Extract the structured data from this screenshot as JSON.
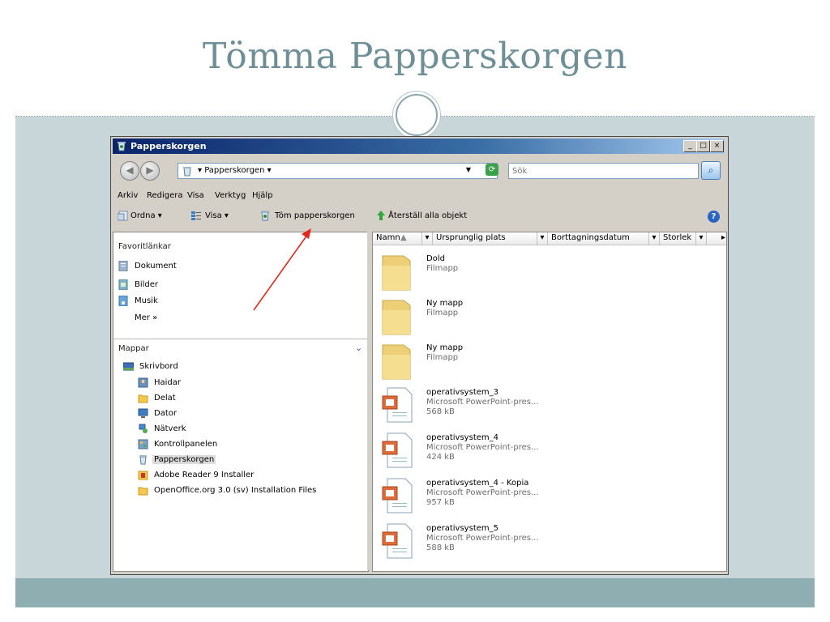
{
  "slide": {
    "title": "Tömma Papperskorgen"
  },
  "window": {
    "title": "Papperskorgen",
    "controls": {
      "minimize": "_",
      "maximize": "□",
      "close": "×"
    },
    "address": {
      "location": "▾ Papperskorgen ▾",
      "search_placeholder": "Sök"
    },
    "menu": [
      "Arkiv",
      "Redigera",
      "Visa",
      "Verktyg",
      "Hjälp"
    ],
    "toolbar": {
      "organize": "Ordna ▾",
      "view": "Visa ▾",
      "empty": "Töm papperskorgen",
      "restore": "Återställ alla objekt",
      "help": "?"
    },
    "favorites": {
      "header": "Favoritlänkar",
      "items": [
        "Dokument",
        "Bilder",
        "Musik"
      ],
      "more": "Mer  »"
    },
    "folders": {
      "header": "Mappar",
      "items": [
        {
          "label": "Skrivbord",
          "icon": "desktop-icon"
        },
        {
          "label": "Haidar",
          "icon": "user-folder-icon"
        },
        {
          "label": "Delat",
          "icon": "folder-icon"
        },
        {
          "label": "Dator",
          "icon": "computer-icon"
        },
        {
          "label": "Nätverk",
          "icon": "network-icon"
        },
        {
          "label": "Kontrollpanelen",
          "icon": "control-panel-icon"
        },
        {
          "label": "Papperskorgen",
          "icon": "recycle-bin-icon"
        },
        {
          "label": "Adobe Reader 9 Installer",
          "icon": "installer-icon"
        },
        {
          "label": "OpenOffice.org 3.0 (sv) Installation Files",
          "icon": "folder-icon"
        }
      ]
    },
    "columns": [
      "Namn",
      "Ursprunglig plats",
      "Borttagningsdatum",
      "Storlek"
    ],
    "files": [
      {
        "name": "Dold",
        "type": "Filmapp",
        "size": "",
        "kind": "folder"
      },
      {
        "name": "Ny mapp",
        "type": "Filmapp",
        "size": "",
        "kind": "folder"
      },
      {
        "name": "Ny mapp",
        "type": "Filmapp",
        "size": "",
        "kind": "folder"
      },
      {
        "name": "operativsystem_3",
        "type": "Microsoft PowerPoint-pres...",
        "size": "568 kB",
        "kind": "ppt"
      },
      {
        "name": "operativsystem_4",
        "type": "Microsoft PowerPoint-pres...",
        "size": "424 kB",
        "kind": "ppt"
      },
      {
        "name": "operativsystem_4 - Kopia",
        "type": "Microsoft PowerPoint-pres...",
        "size": "957 kB",
        "kind": "ppt"
      },
      {
        "name": "operativsystem_5",
        "type": "Microsoft PowerPoint-pres...",
        "size": "588 kB",
        "kind": "ppt"
      }
    ]
  },
  "colors": {
    "title": "#6d8f95",
    "arrow": "#e8261c",
    "slide_bg": "#c8d5d9",
    "footer": "#8faeb2"
  }
}
